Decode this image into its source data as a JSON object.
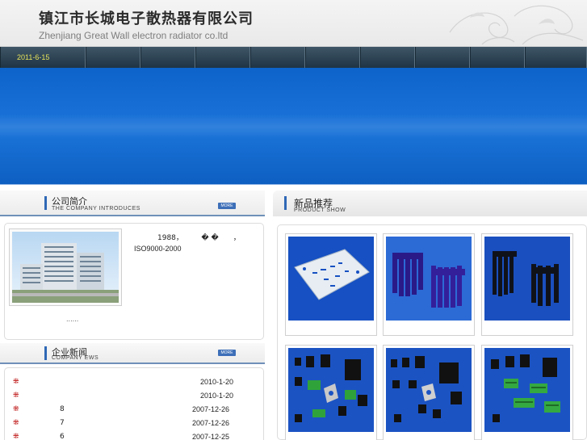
{
  "header": {
    "title_cn": "镇江市长城电子散热器有限公司",
    "title_en": "Zhenjiang Great Wall electron radiator co.ltd"
  },
  "nav": {
    "date": "2011-6-15",
    "items": [
      "",
      "",
      "",
      "",
      "",
      "",
      "",
      "",
      ""
    ]
  },
  "about": {
    "title": "公司简介",
    "subtitle": "THE COMPANY INTRODUCES",
    "more": "MORE",
    "line1": "1988，　　　� �　　，",
    "line2": "ISO9000-2000",
    "ellipsis": "......"
  },
  "news": {
    "title": "企业新闻",
    "subtitle": "COMPANY EWS",
    "more": "MORE",
    "bullet": "⁜",
    "rows": [
      {
        "title": "",
        "date": "2010-1-20"
      },
      {
        "title": "",
        "date": "2010-1-20"
      },
      {
        "title": "8",
        "date": "2007-12-26"
      },
      {
        "title": "7",
        "date": "2007-12-26"
      },
      {
        "title": "6",
        "date": "2007-12-25"
      }
    ]
  },
  "products": {
    "title": "新品推荐",
    "subtitle": "PRODUCT SHOW",
    "items": [
      {
        "icon": "aluminum-plate",
        "caption": ""
      },
      {
        "icon": "purple-heatsink",
        "caption": ""
      },
      {
        "icon": "black-heatsink",
        "caption": ""
      },
      {
        "icon": "heatsink-set-1",
        "caption": ""
      },
      {
        "icon": "heatsink-set-2",
        "caption": ""
      },
      {
        "icon": "green-heatsink-set",
        "caption": ""
      }
    ]
  },
  "colors": {
    "banner": "#1a70d5",
    "nav": "#2e4555",
    "accent": "#2f68b6",
    "date": "#e7e35a"
  }
}
